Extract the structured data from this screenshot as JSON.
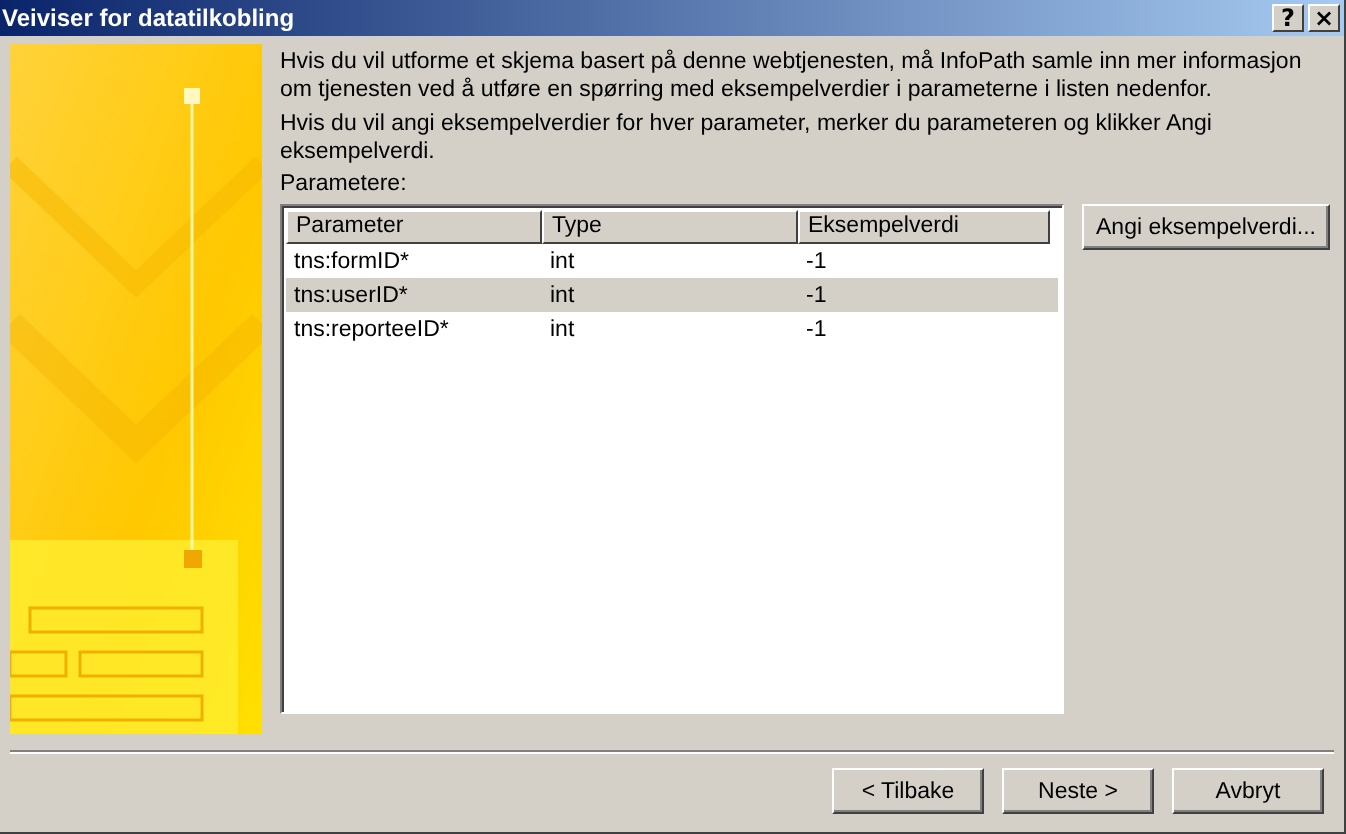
{
  "window": {
    "title": "Veiviser for datatilkobling",
    "title_buttons": [
      "?",
      "×"
    ]
  },
  "intro": [
    "Hvis du vil utforme et skjema basert på denne webtjenesten, må InfoPath samle inn mer informasjon om tjenesten ved å utføre en spørring med eksempelverdier i parameterne i listen nedenfor.",
    "Hvis du vil angi eksempelverdier for hver parameter, merker du parameteren og klikker Angi eksempelverdi."
  ],
  "list_label": "Parametere:",
  "table": {
    "columns": [
      "Parameter",
      "Type",
      "Eksempelverdi"
    ],
    "rows": [
      {
        "cells": [
          "tns:formID*",
          "int",
          "-1"
        ],
        "selected": false
      },
      {
        "cells": [
          "tns:userID*",
          "int",
          "-1"
        ],
        "selected": true
      },
      {
        "cells": [
          "tns:reporteeID*",
          "int",
          "-1"
        ],
        "selected": false
      }
    ]
  },
  "side_button": "Angi eksempelverdi...",
  "buttons": [
    "< Tilbake",
    "Neste >",
    "Avbryt"
  ]
}
